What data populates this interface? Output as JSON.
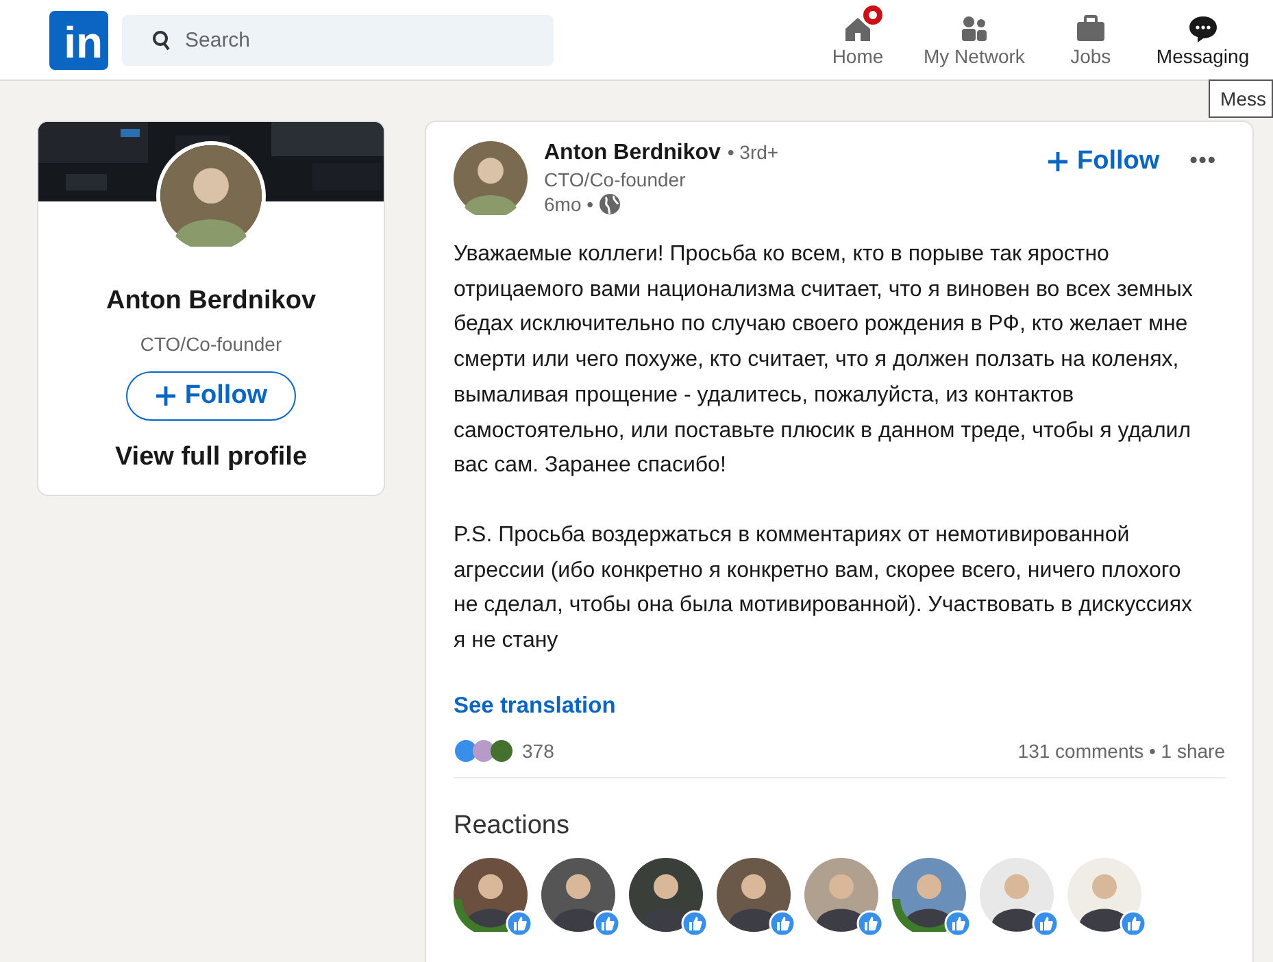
{
  "header": {
    "logo": "in",
    "search": {
      "placeholder": "Search"
    },
    "nav": [
      {
        "label": "Home",
        "selected": false,
        "badge": true
      },
      {
        "label": "My Network",
        "selected": false,
        "badge": false
      },
      {
        "label": "Jobs",
        "selected": false,
        "badge": false
      },
      {
        "label": "Messaging",
        "selected": true,
        "badge": false
      }
    ],
    "tooltip": "Mess"
  },
  "profile_card": {
    "name": "Anton Berdnikov",
    "headline": "CTO/Co-founder",
    "follow": "Follow",
    "view_profile": "View full profile"
  },
  "post": {
    "author": "Anton Berdnikov",
    "degree": "• 3rd+",
    "headline": "CTO/Co-founder",
    "time": "6mo •",
    "follow": "Follow",
    "more": "•••",
    "paragraphs": [
      "Уважаемые коллеги! Просьба ко всем, кто в порыве так яростно отрицаемого вами национализма считает, что я виновен во всех земных бедах исключительно по случаю своего рождения в РФ, кто желает мне смерти или чего похуже, кто считает, что я должен ползать на коленях, вымаливая прощение - удалитесь, пожалуйста, из контактов самостоятельно, или поставьте плюсик в данном треде, чтобы я удалил вас сам. Заранее спасибо!",
      "P.S. Просьба воздержаться в комментариях от немотивированной агрессии (ибо конкретно я конкретно вам, скорее всего, ничего плохого не сделал, чтобы она была мотивированной). Участвовать в дискуссиях я не стану"
    ],
    "see_translation": "See translation",
    "reaction_count": "378",
    "comments": "131 comments • 1 share",
    "reactions_title": "Reactions",
    "reactors": [
      {
        "open_to_work": true,
        "color": "#6b5040"
      },
      {
        "open_to_work": false,
        "color": "#555555"
      },
      {
        "open_to_work": false,
        "color": "#3a3f3a"
      },
      {
        "open_to_work": false,
        "color": "#6a5848"
      },
      {
        "open_to_work": false,
        "color": "#b0a090"
      },
      {
        "open_to_work": true,
        "color": "#6a8fb8"
      },
      {
        "open_to_work": false,
        "color": "#e8e8e8"
      },
      {
        "open_to_work": false,
        "color": "#f0ece6"
      }
    ]
  }
}
